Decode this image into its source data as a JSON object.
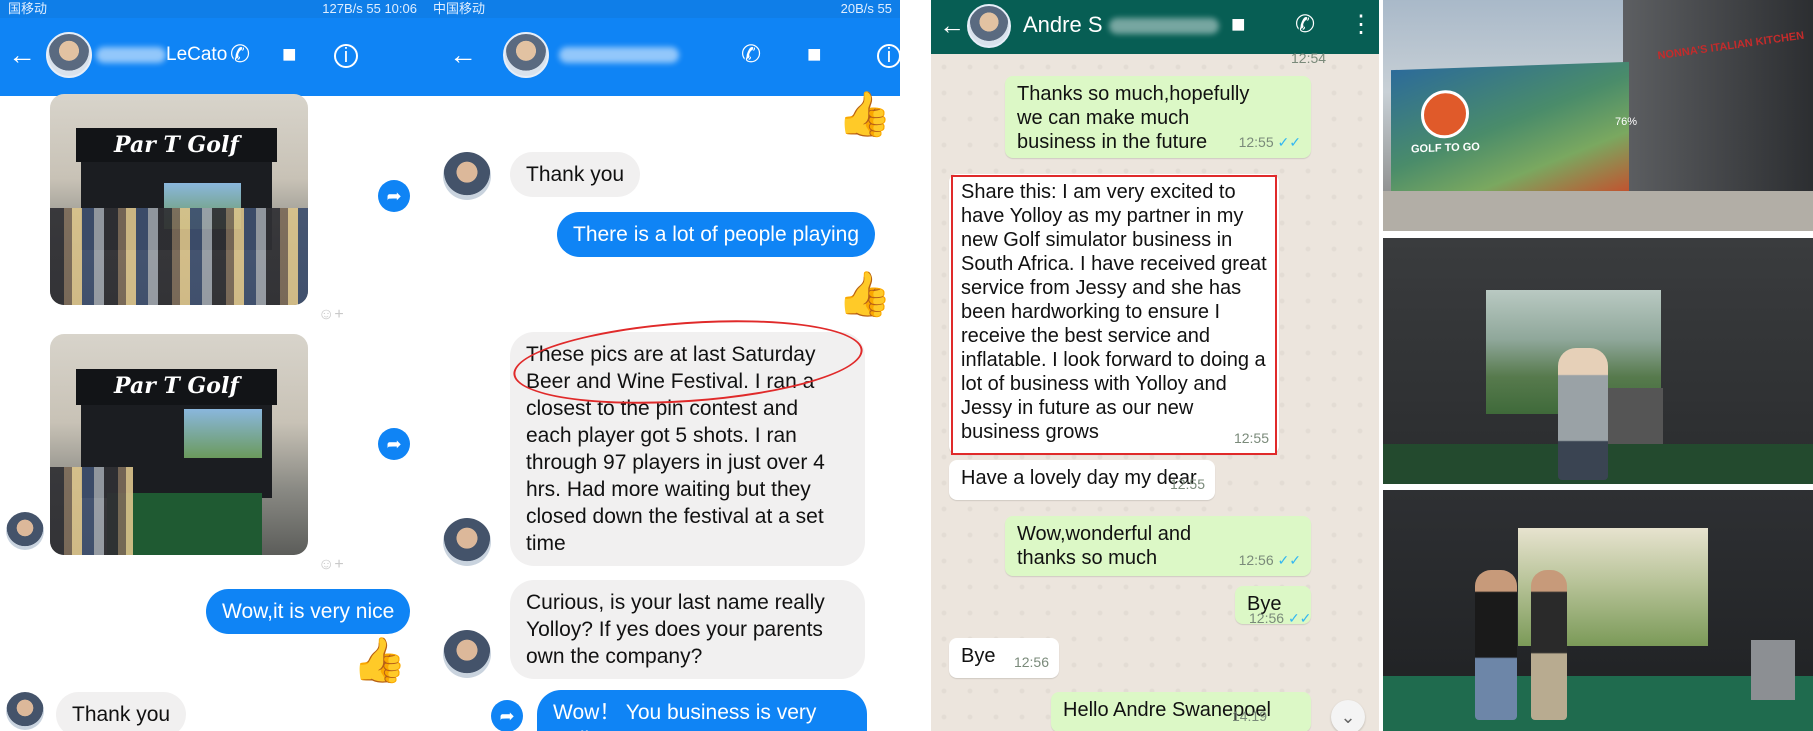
{
  "panel1": {
    "status": {
      "left": "国移动",
      "right": "127B/s 55 10:06"
    },
    "contact_name": "LeCato",
    "images": [
      {
        "sign": "Par T Golf"
      },
      {
        "sign": "Par T Golf"
      }
    ],
    "messages": [
      {
        "dir": "out",
        "text": "Wow,it is very nice"
      },
      {
        "dir": "in",
        "text": "Thank you"
      }
    ]
  },
  "panel2": {
    "status": {
      "left": "中国移动",
      "right": "20B/s 55"
    },
    "messages": [
      {
        "dir": "in",
        "text": "Thank you"
      },
      {
        "dir": "out",
        "text": "There is a lot of people playing"
      },
      {
        "dir": "in",
        "text": "These pics are at last Saturday Beer and Wine Festival. I ran a closest to the pin contest and each player got 5 shots. I ran through 97 players in just over 4 hrs. Had more waiting but they closed down the festival at a set time"
      },
      {
        "dir": "in",
        "text": "Curious, is your last name really Yolloy? If yes does your parents own the company?"
      },
      {
        "dir": "out",
        "text": "Wow！ You business is very well."
      }
    ]
  },
  "panel3": {
    "contact_name": "Andre S",
    "top_time": "12:54",
    "messages": [
      {
        "dir": "out",
        "text": "Thanks so much,hopefully we can make much business in the future",
        "time": "12:55"
      },
      {
        "dir": "in",
        "text": "Share this: I am very excited to have Yolloy as my partner in my new Golf simulator business in South Africa. I have received great service from Jessy and she has been hardworking to ensure I receive the best service and inflatable. I look forward to doing a lot of business with Yolloy and Jessy in future as our new business grows",
        "time": "12:55"
      },
      {
        "dir": "in",
        "text": "Have a lovely day my dear",
        "time": "12:55"
      },
      {
        "dir": "out",
        "text": "Wow,wonderful and thanks so much",
        "time": "12:56"
      },
      {
        "dir": "out",
        "text": "Bye",
        "time": "12:56"
      },
      {
        "dir": "in",
        "text": "Bye",
        "time": "12:56"
      },
      {
        "dir": "out",
        "text": "Hello Andre Swanepoel",
        "time": "14:19"
      }
    ]
  },
  "panel4": {
    "photo1": {
      "banner_text": "GOLF TO GO",
      "percent": "76%",
      "store_sign": "NONNA'S ITALIAN KITCHEN"
    }
  },
  "icons": {
    "back": "arrow-left-icon",
    "phone": "phone-icon",
    "video": "video-camera-icon",
    "info": "info-icon",
    "share": "share-icon",
    "like": "thumbs-up-icon",
    "more": "more-vert-icon",
    "scroll_down": "chevron-down-icon"
  },
  "colors": {
    "messenger_blue": "#0f84f5",
    "whatsapp_header": "#075e54",
    "whatsapp_out": "#dcf8c6",
    "highlight_red": "#e02a2a"
  }
}
